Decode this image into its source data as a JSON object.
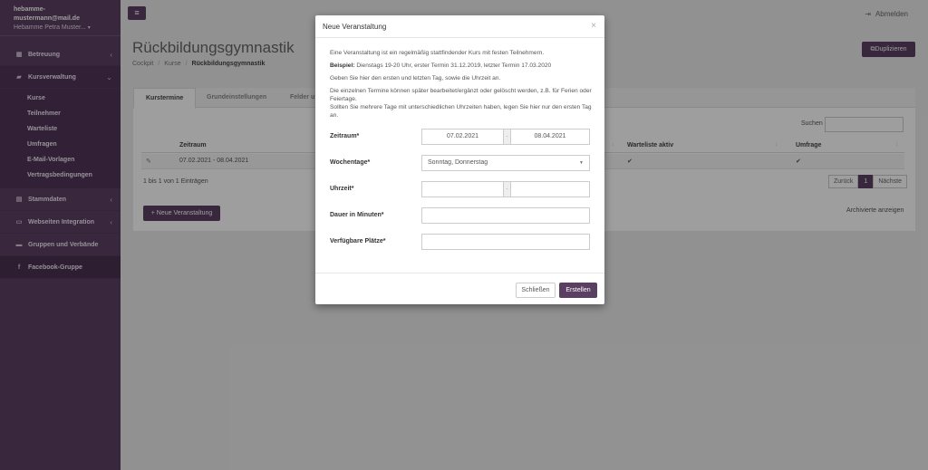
{
  "user": {
    "email": "hebamme-mustermann@mail.de",
    "name": "Hebamme Petra Muster...",
    "caret": "▾"
  },
  "sidebar": {
    "items": [
      {
        "label": "Betreuung",
        "icon": "calendar-icon",
        "glyph": "▦",
        "chevron": "‹"
      },
      {
        "label": "Kursverwaltung",
        "icon": "graduation-cap-icon",
        "glyph": "▰",
        "chevron": "⌄"
      },
      {
        "label": "Stammdaten",
        "icon": "document-icon",
        "glyph": "▤",
        "chevron": "‹"
      },
      {
        "label": "Webseiten Integration",
        "icon": "monitor-icon",
        "glyph": "▭",
        "chevron": "‹"
      },
      {
        "label": "Gruppen und Verbände",
        "icon": "briefcase-icon",
        "glyph": "▬"
      },
      {
        "label": "Facebook-Gruppe",
        "icon": "facebook-icon",
        "glyph": "f"
      }
    ],
    "submenu": [
      "Kurse",
      "Teilnehmer",
      "Warteliste",
      "Umfragen",
      "E-Mail-Vorlagen",
      "Vertragsbedingungen"
    ]
  },
  "topbar": {
    "menu_glyph": "≡",
    "logout_glyph": "⇥",
    "logout": "Abmelden"
  },
  "page": {
    "title": "Rückbildungsgymnastik",
    "breadcrumb": [
      "Cockpit",
      "Kurse",
      "Rückbildungsgymnastik"
    ],
    "breadcrumb_sep": "/",
    "duplicate": "Duplizieren",
    "duplicate_glyph": "⧉"
  },
  "panel": {
    "tabs": [
      "Kurstermine",
      "Grundeinstellungen",
      "Felder u"
    ],
    "search_label": "Suchen",
    "columns": [
      "Zeitraum",
      "Warteliste aktiv",
      "Umfrage"
    ],
    "row": {
      "zeitraum": "07.02.2021 - 08.04.2021",
      "warteliste": "✔",
      "umfrage": "✔"
    },
    "edit_glyph": "✎",
    "sort_glyph": "↕",
    "info": "1 bis 1 von 1 Einträgen",
    "pager": {
      "prev": "Zurück",
      "page": "1",
      "next": "Nächste"
    },
    "new_button": "Neue Veranstaltung",
    "new_glyph": "+",
    "archived": "Archivierte anzeigen"
  },
  "modal": {
    "title": "Neue Veranstaltung",
    "close_glyph": "×",
    "intro": "Eine Veranstaltung ist ein regelmäßig stattfindender Kurs mit festen Teilnehmern.",
    "example_label": "Beispiel:",
    "example_text": " Dienstags 19-20 Uhr, erster Termin 31.12.2019, letzter Termin 17.03.2020",
    "instruction": "Geben Sie hier den ersten und letzten Tag, sowie die Uhrzeit an.",
    "note1": "Die einzelnen Termine können später bearbeitet/ergänzt oder gelöscht werden, z.B. für Ferien oder Feiertage.",
    "note2": "Sollten Sie mehrere Tage mit unterschiedlichen Uhrzeiten haben, legen Sie hier nur den ersten Tag an.",
    "fields": {
      "zeitraum": {
        "label": "Zeitraum*",
        "from": "07.02.2021",
        "to": "08.04.2021",
        "sep": "-"
      },
      "wochentage": {
        "label": "Wochentage*",
        "value": "Sonntag, Donnerstag",
        "caret": "▼"
      },
      "uhrzeit": {
        "label": "Uhrzeit*",
        "from": "",
        "to": "",
        "sep": "-"
      },
      "dauer": {
        "label": "Dauer in Minuten*",
        "value": ""
      },
      "plaetze": {
        "label": "Verfügbare Plätze*",
        "value": ""
      }
    },
    "close_button": "Schließen",
    "create_button": "Erstellen"
  }
}
